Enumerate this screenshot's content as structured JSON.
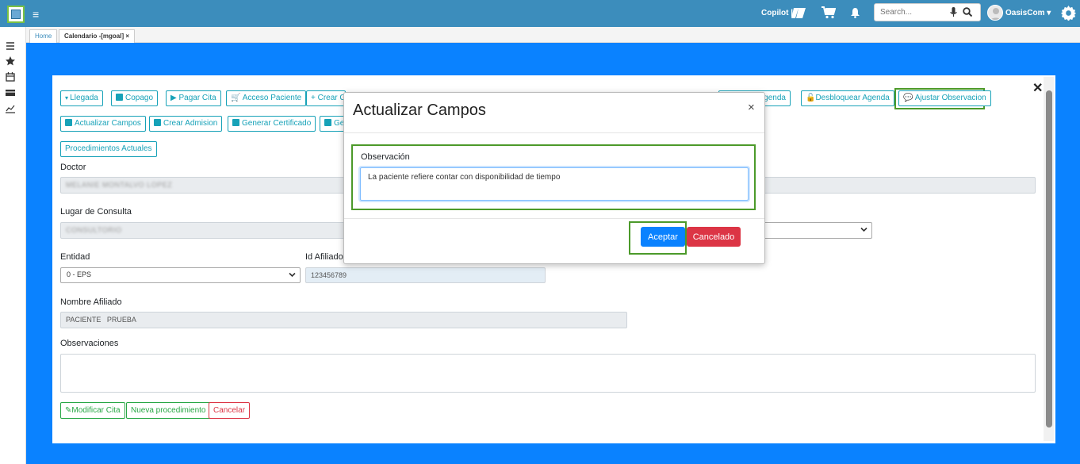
{
  "topbar": {
    "copilot_label": "Copilot |",
    "search_placeholder": "Search...",
    "user_name": "OasisCom ▾"
  },
  "tabs": [
    {
      "label": "Home"
    },
    {
      "label": "Calendario -[mgoal] ×"
    }
  ],
  "toolbar": {
    "llegada": "Llegada",
    "copago": "Copago",
    "pagar_cita": "Pagar Cita",
    "acceso_paciente": "Acceso Paciente",
    "crear": "Crear C",
    "agenda_fragment": "Agenda",
    "desbloquear_agenda": "Desbloquear Agenda",
    "ajustar_observacion": "Ajustar Observacion",
    "actualizar_campos": "Actualizar Campos",
    "crear_admision": "Crear Admision",
    "generar_certificado": "Generar Certificado",
    "gen_fragment": "Ger",
    "procedimientos_actuales": "Procedimientos Actuales"
  },
  "form": {
    "doctor_label": "Doctor",
    "doctor_value": "MELANIE MONTALVO LOPEZ",
    "lugar_label": "Lugar de Consulta",
    "lugar_value": "CONSULTORIO",
    "entidad_label": "Entidad",
    "entidad_value": "0 - EPS",
    "id_afiliado_label": "Id Afiliado",
    "id_afiliado_value": "123456789",
    "nombre_label": "Nombre Afiliado",
    "nombre_value": "PACIENTE   PRUEBA",
    "observaciones_label": "Observaciones"
  },
  "actions": {
    "modificar_cita": "Modificar Cita",
    "nuevo_procedimiento": "Nueva procedimiento",
    "cancelar": "Cancelar"
  },
  "modal": {
    "title": "Actualizar Campos",
    "close": "×",
    "field_label": "Observación",
    "field_value": "La paciente refiere contar con disponibilidad de tiempo",
    "accept": "Aceptar",
    "cancel": "Cancelado"
  },
  "colors": {
    "topbar": "#3c8dbc",
    "background": "#0a82ff",
    "highlight": "#4c9a2a",
    "outline_btn": "#17a2b8"
  }
}
